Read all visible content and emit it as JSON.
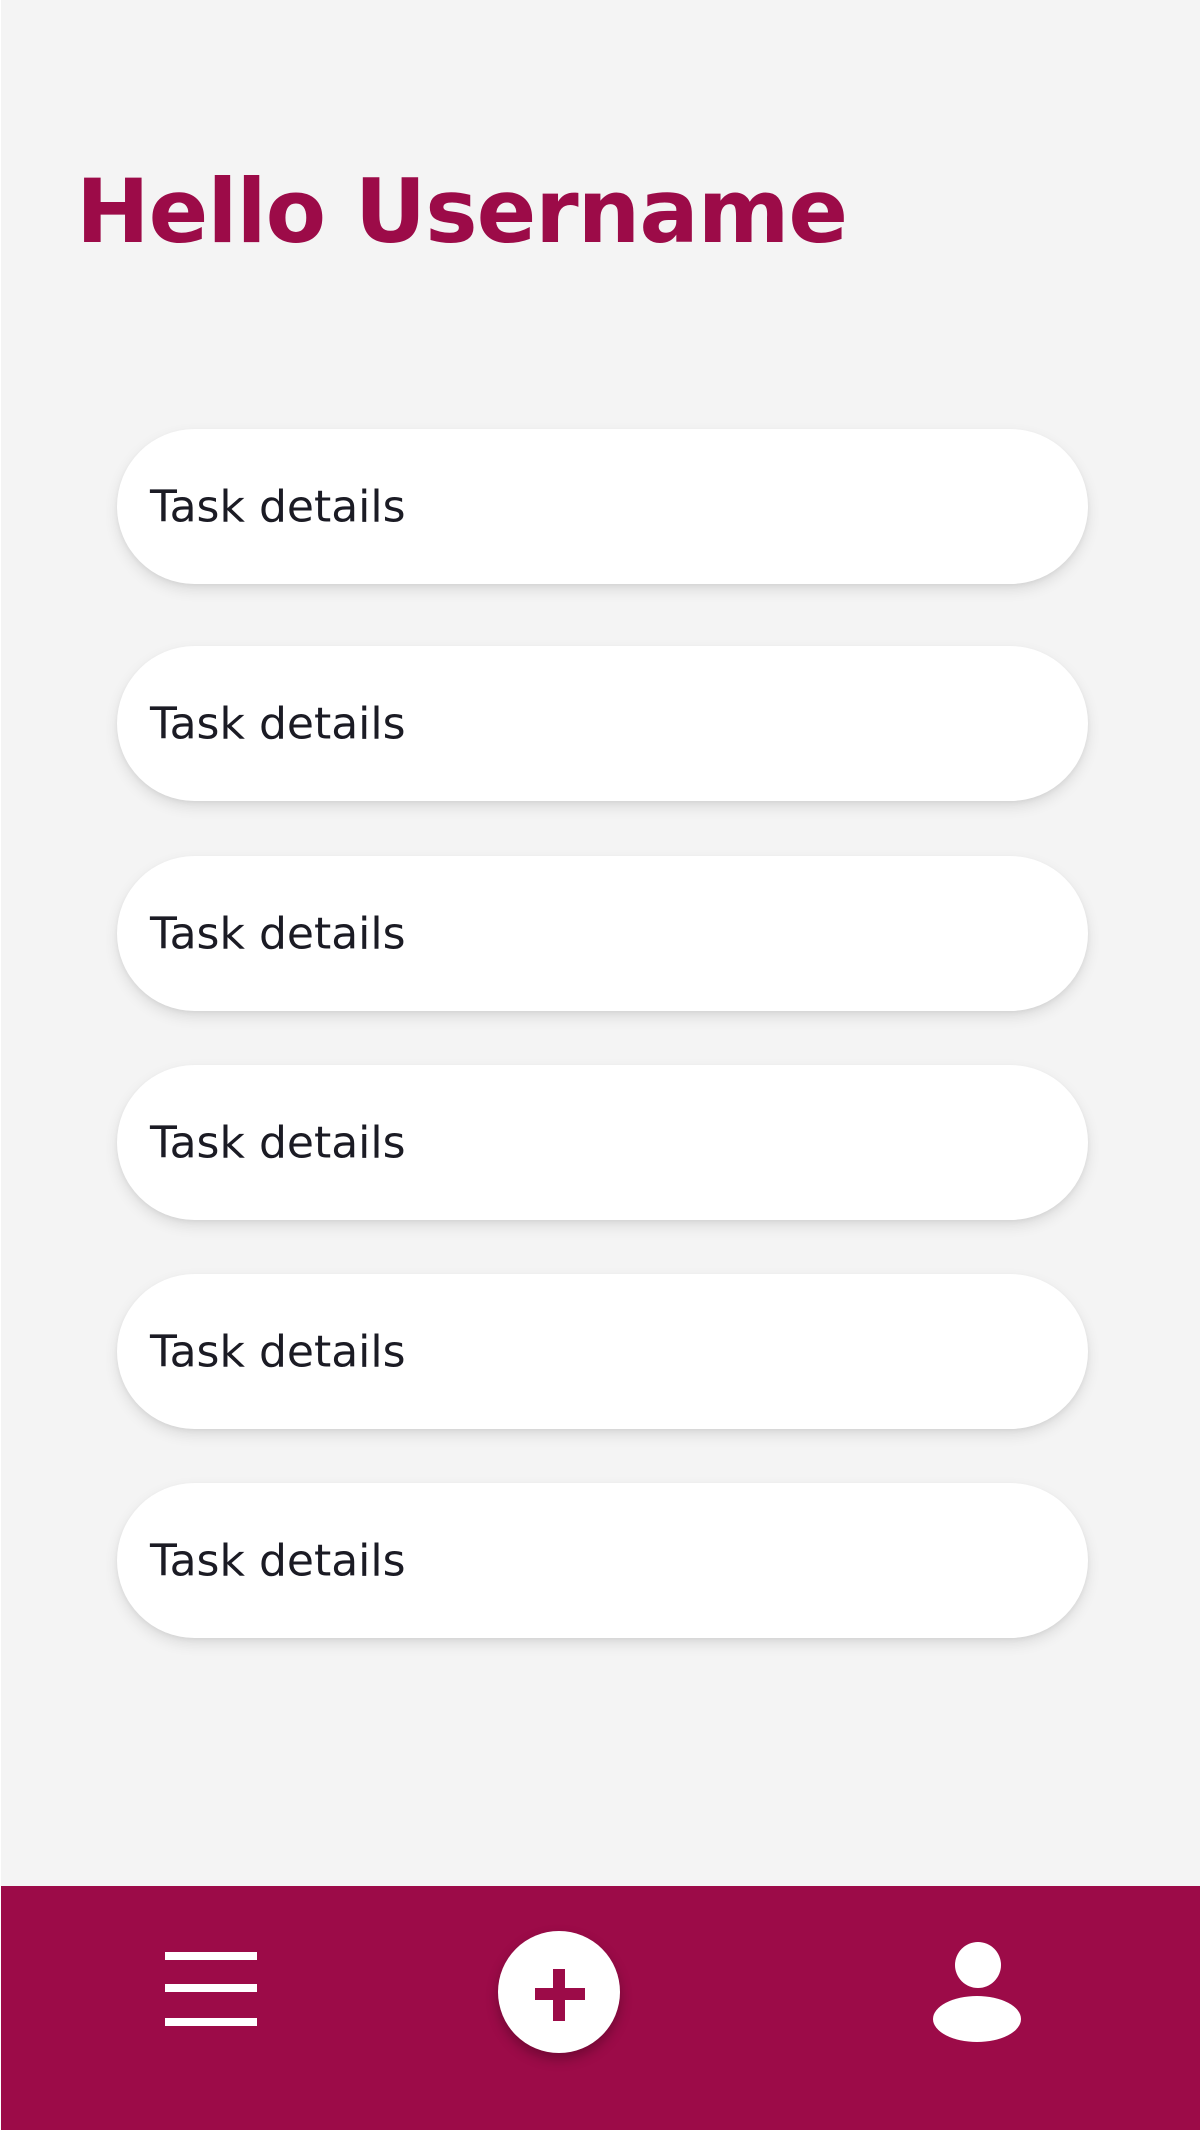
{
  "header": {
    "greeting": "Hello Username"
  },
  "tasks": [
    {
      "label": "Task details"
    },
    {
      "label": "Task details"
    },
    {
      "label": "Task details"
    },
    {
      "label": "Task details"
    },
    {
      "label": "Task details"
    },
    {
      "label": "Task details"
    }
  ],
  "bottom_nav": {
    "items": [
      {
        "icon": "hamburger-menu-icon"
      },
      {
        "icon": "plus-icon"
      },
      {
        "icon": "user-profile-icon"
      }
    ]
  },
  "colors": {
    "accent": "#9c0b48",
    "background": "#f4f4f4",
    "card": "#ffffff",
    "text": "#1b1b24"
  }
}
